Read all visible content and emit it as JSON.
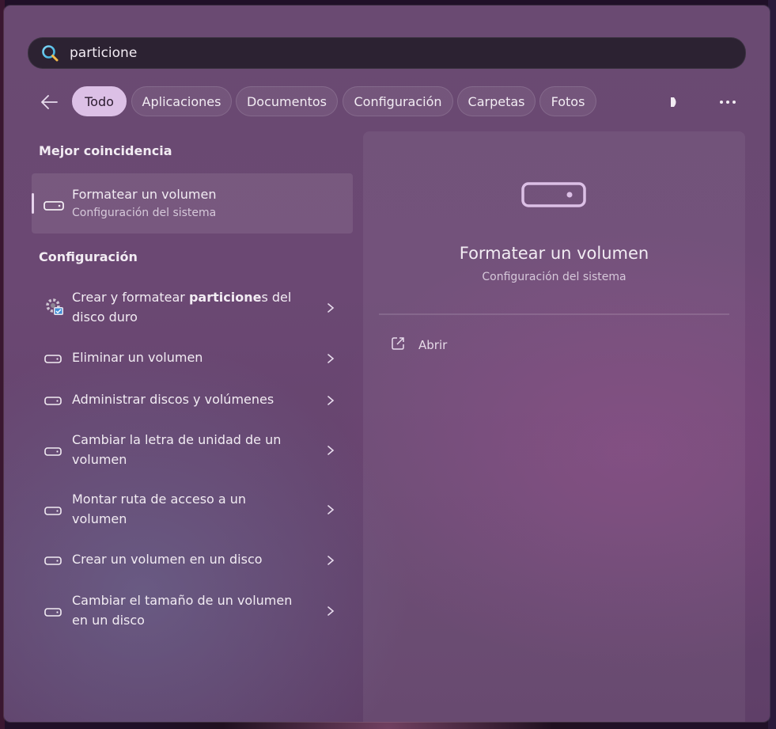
{
  "search": {
    "value": "particione",
    "placeholder": ""
  },
  "filters": [
    "Todo",
    "Aplicaciones",
    "Documentos",
    "Configuración",
    "Carpetas",
    "Fotos"
  ],
  "active_filter": "Todo",
  "best_match": {
    "heading": "Mejor coincidencia",
    "title": "Formatear un volumen",
    "subtitle": "Configuración del sistema",
    "icon": "drive-icon"
  },
  "settings": {
    "heading": "Configuración",
    "items": [
      {
        "pre": "Crear y formatear ",
        "bold": "particione",
        "post": "s del disco duro",
        "icon": "system-settings-icon"
      },
      {
        "pre": "Eliminar un volumen",
        "bold": "",
        "post": "",
        "icon": "drive-icon"
      },
      {
        "pre": "Administrar discos y volúmenes",
        "bold": "",
        "post": "",
        "icon": "drive-icon"
      },
      {
        "pre": "Cambiar la letra de unidad de un volumen",
        "bold": "",
        "post": "",
        "icon": "drive-icon"
      },
      {
        "pre": "Montar ruta de acceso a un volumen",
        "bold": "",
        "post": "",
        "icon": "drive-icon"
      },
      {
        "pre": "Crear un volumen en un disco",
        "bold": "",
        "post": "",
        "icon": "drive-icon"
      },
      {
        "pre": "Cambiar el tamaño de un volumen en un disco",
        "bold": "",
        "post": "",
        "icon": "drive-icon"
      }
    ]
  },
  "preview": {
    "title": "Formatear un volumen",
    "subtitle": "Configuración del sistema",
    "open_label": "Abrir",
    "icon": "drive-icon"
  },
  "colors": {
    "accent_chip": "#dcc0e6",
    "window": "#6a4a72"
  }
}
